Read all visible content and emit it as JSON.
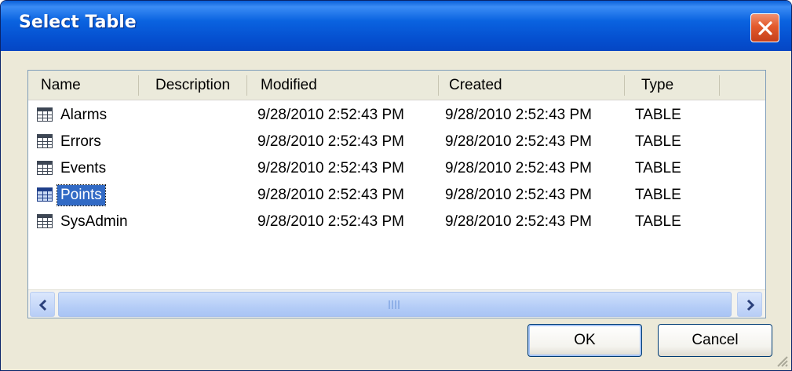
{
  "window": {
    "title": "Select Table"
  },
  "columns": [
    "Name",
    "Description",
    "Modified",
    "Created",
    "Type"
  ],
  "rows": [
    {
      "name": "Alarms",
      "description": "",
      "modified": "9/28/2010 2:52:43 PM",
      "created": "9/28/2010 2:52:43 PM",
      "type": "TABLE"
    },
    {
      "name": "Errors",
      "description": "",
      "modified": "9/28/2010 2:52:43 PM",
      "created": "9/28/2010 2:52:43 PM",
      "type": "TABLE"
    },
    {
      "name": "Events",
      "description": "",
      "modified": "9/28/2010 2:52:43 PM",
      "created": "9/28/2010 2:52:43 PM",
      "type": "TABLE"
    },
    {
      "name": "Points",
      "description": "",
      "modified": "9/28/2010 2:52:43 PM",
      "created": "9/28/2010 2:52:43 PM",
      "type": "TABLE",
      "selected": true
    },
    {
      "name": "SysAdmin",
      "description": "",
      "modified": "9/28/2010 2:52:43 PM",
      "created": "9/28/2010 2:52:43 PM",
      "type": "TABLE"
    }
  ],
  "buttons": {
    "ok": "OK",
    "cancel": "Cancel"
  },
  "icons": {
    "row_icon": "table-icon",
    "close": "close-icon"
  },
  "colors": {
    "titlebar": "#0a5fd8",
    "selection": "#316ac5",
    "close": "#e35a2c"
  }
}
